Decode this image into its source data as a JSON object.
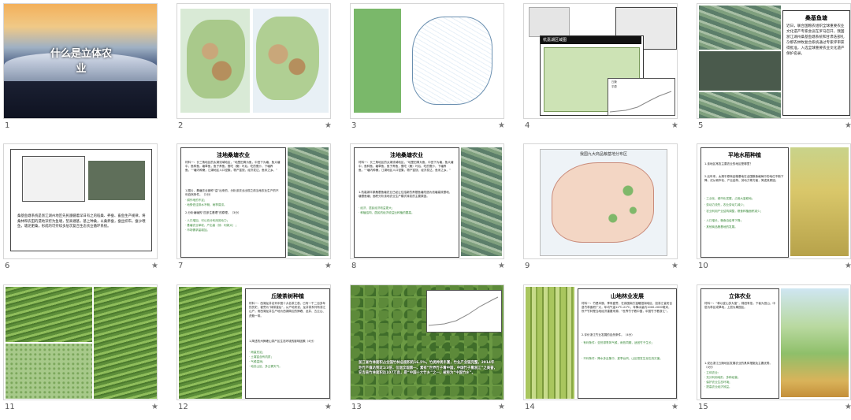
{
  "slides": [
    {
      "number": "1",
      "star": "",
      "title": "什么是立体农业"
    },
    {
      "number": "2",
      "star": "★"
    },
    {
      "number": "3",
      "star": "★"
    },
    {
      "number": "4",
      "star": "★",
      "map_title": "杭嘉湖区域图",
      "legend": [
        "丘陵",
        "平原"
      ]
    },
    {
      "number": "5",
      "star": "★",
      "heading": "桑基鱼塘",
      "text": "近日，联合国粮农组织全球重要农业文化遗产专家会议在罗马召开，我国浙江湖州桑基鱼塘系统和甘肃迭部扎尕那农林牧复合系统通过专家评审获得批准，入选全球重要农业文化遗产保护名录。"
    },
    {
      "number": "6",
      "star": "★",
      "text": "桑基鱼塘系统是浙江湖州地区先民遵循着早日有之的稻桑、养蚕、畜鱼生产规律，将桑林和农田的遗地深挖为鱼塘，垫高塘基，基上种桑，以桑养蚕，蚕丝织布，蚕沙喂鱼，塘泥肥桑，形成的可持续多层次复合生态农业循环系统。"
    },
    {
      "number": "7",
      "star": "★",
      "heading": "洼地桑塘农业",
      "material": "材料一：长三角地区的太湖流域地区，“地里田周为鱼，中田下为塘，鱼大塘中，鱼种鱼，塘草鱼，鱼子养鱼，蚕吃（桑）叶后，吃的蚕沙，下塘养鱼。”“塘内种桑，江湖地区人口密集，物产富饶，经济发达，鱼米之乡。”",
      "questions": [
        "1.图片，基塘农业被称“溢”出来的，分析该农业出现之前当地农业生产的不利自然条件。（2分）",
        "2.分析塘塘的“四多生基理”的原理。（3分）"
      ],
      "items": [
        "· 耕作地的不足；",
        "· 地势低洼排水不畅，雨季易涝。",
        "· 人口增加，可以充分利用劳动力；",
        "· 基塘农业单收，产出高（效：利润大）；",
        "· 市场需求量增加。"
      ]
    },
    {
      "number": "8",
      "star": "★",
      "heading": "洼地桑塘农业",
      "material": "材料一：长三角地区的太湖流域地区，“地里田周为鱼，中田下为塘，鱼大塘中，鱼种鱼，塘草鱼，鱼子养鱼，蚕吃（桑）叶后，吃的蚕沙，下塘养鱼。”“塘内种桑，江湖地区人口密集，物产富饶，经济发达，鱼米之乡。”",
      "questions": [
        "1.杭嘉湖平原桑基鱼塘农业已经让位给新的养基鱼塘改造为池塘高效基地，塘基鱼塘；面积分析该地农业生产模式转变的主要原因。"
      ],
      "items": [
        "· 经济、居民经济收益更大；",
        "· 种植结构，居民的经济收益比种植的要高。"
      ]
    },
    {
      "number": "9",
      "star": "★",
      "map_title": "我国九大商品粮基地分布区"
    },
    {
      "number": "10",
      "star": "★",
      "heading": "平地水稻种植",
      "questions": [
        "1.该地区常态主要农业的地区是哪里？",
        "2.近年来，太湖平原商品粮基地在全国粮食格局中的地位不断下降，试从城市化、产业结构、劳动力等方面，简述其原因。"
      ],
      "items": [
        "· 工业化、城市化发展，占用大量耕地；",
        "· 劳动力流失，农业劳动力减少；",
        "· 农业利用产业结构调整，粮食种植面积减少；",
        "· 人口增长，粮食自给率下降；",
        "· 其他商品粮基地的发展。"
      ]
    },
    {
      "number": "11",
      "star": "★"
    },
    {
      "number": "12",
      "star": "★",
      "heading": "丘陵茶树种植",
      "material": "材料一：西湖龙井名列中国十大名茶之首，已有一千二百多年的历史，被誉为“绿茶皇后”，从产地来说，龙井茶系列有浙江山产，而西湖龙井生产地为西湖周边的狮峰、龙井、五云山、虎跑一带。",
      "questions": [
        "1.简述杭州狮峰山茶产区生态环境的影响因素（4分）"
      ],
      "items": [
        "· 雨量充足；",
        "· 土壤富含有机质；",
        "· 气候温润；",
        "· 地处山区，多云雾天气。"
      ]
    },
    {
      "number": "13",
      "star": "★",
      "text": "浙江省竹林面积占全国竹林总面积的16.5%，竹类种类丰富，竹业产业链完整，2014年毛竹产值达到近1/3倍，位居全国第一。素有“世界竹子看中国，中国竹子看浙江”之美誉，安吉县竹林面积达107万亩，是“中国十大竹乡”之一，被称为“中国竹乡”。"
    },
    {
      "number": "14",
      "star": "★",
      "heading": "山地林业发展",
      "material": "材料一：竹是本属，享有盛誉，在我国南方温暖湿润地区，如浙江省安吉县竹林面积广大，年均气温12℃-22℃，年降水量约1000-2000毫米，所产竹林是当地经济重要来源，“世界竹子看中国，中国竹子看浙江”。",
      "questions": [
        "2.评价浙江竹业发展的自然条件。（4分）"
      ],
      "items": [
        "· 有利条件：亚热带季风气候，雨热同期，适宜竹子生长；",
        "· 不利条件：降水多且集中，夏季台风，山区易发生泥石流灾害。"
      ]
    },
    {
      "number": "15",
      "star": "★",
      "heading": "立体农业",
      "material": "材料一：“种以宜山多为宝”，梯田有信，下者为田山，中层为林区或草地，上层为果园区。",
      "questions": [
        "1.说出浙江丘陵地区发展农业的具体措施及主要优势。（4分）"
      ],
      "items": [
        "· 立体农业：",
        "· 充分利用地形，多种经营；",
        "· 保护农业生态环境；",
        "· 提高农业经济效益。"
      ]
    }
  ]
}
